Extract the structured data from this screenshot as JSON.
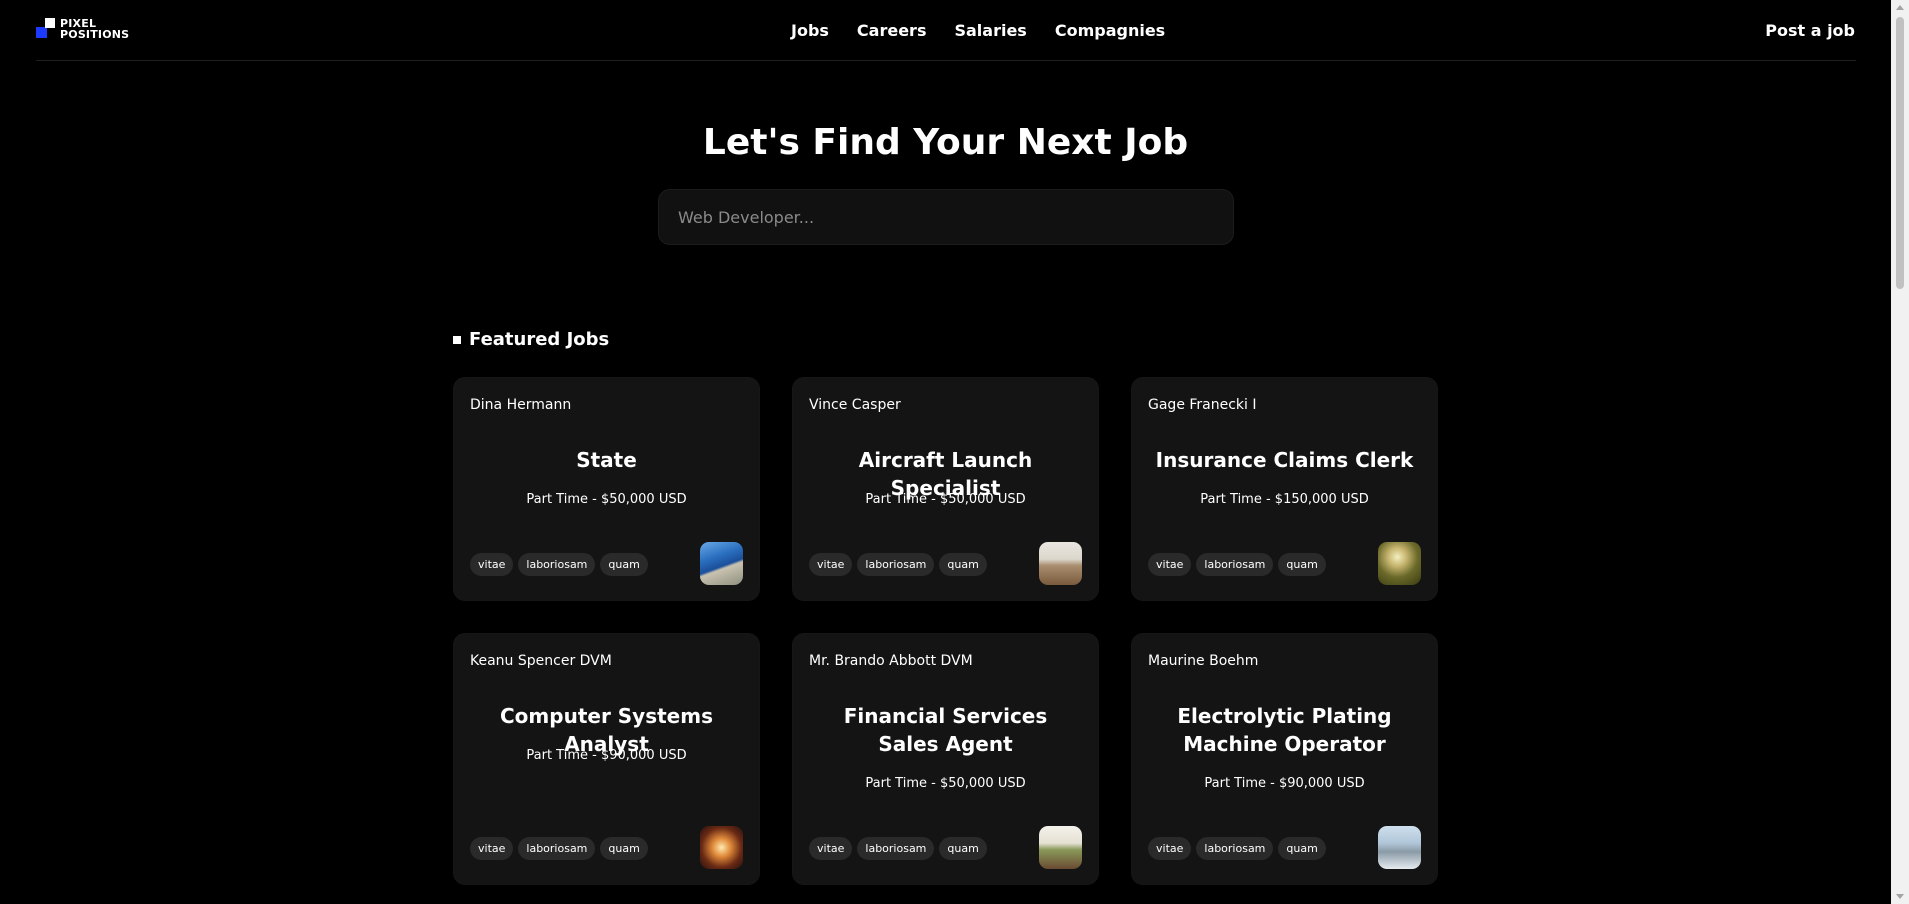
{
  "header": {
    "logo_line1": "PIXEL",
    "logo_line2": "POSITIONS",
    "nav": [
      "Jobs",
      "Careers",
      "Salaries",
      "Compagnies"
    ],
    "post_job": "Post a job"
  },
  "hero": {
    "title": "Let's Find Your Next Job",
    "search_placeholder": "Web Developer..."
  },
  "featured": {
    "heading": "Featured Jobs",
    "cards": [
      {
        "employer": "Dina Hermann",
        "title": "State",
        "salary": "Part Time - $50,000 USD",
        "tags": [
          "vitae",
          "laboriosam",
          "quam"
        ],
        "thumb_icon": "employer-logo-image"
      },
      {
        "employer": "Vince Casper",
        "title": "Aircraft Launch Specialist",
        "salary": "Part Time - $50,000 USD",
        "tags": [
          "vitae",
          "laboriosam",
          "quam"
        ],
        "thumb_icon": "employer-logo-image"
      },
      {
        "employer": "Gage Franecki I",
        "title": "Insurance Claims Clerk",
        "salary": "Part Time - $150,000 USD",
        "tags": [
          "vitae",
          "laboriosam",
          "quam"
        ],
        "thumb_icon": "employer-logo-image"
      },
      {
        "employer": "Keanu Spencer DVM",
        "title": "Computer Systems Analyst",
        "salary": "Part Time - $90,000 USD",
        "tags": [
          "vitae",
          "laboriosam",
          "quam"
        ],
        "thumb_icon": "employer-logo-image"
      },
      {
        "employer": "Mr. Brando Abbott DVM",
        "title": "Financial Services Sales Agent",
        "salary": "Part Time - $50,000 USD",
        "tags": [
          "vitae",
          "laboriosam",
          "quam"
        ],
        "thumb_icon": "employer-logo-image"
      },
      {
        "employer": "Maurine Boehm",
        "title": "Electrolytic Plating Machine Operator",
        "salary": "Part Time - $90,000 USD",
        "tags": [
          "vitae",
          "laboriosam",
          "quam"
        ],
        "thumb_icon": "employer-logo-image"
      }
    ]
  },
  "colors": {
    "background": "#000000",
    "card": "#141414",
    "tag": "#2a2a2a",
    "logo_accent": "#1d3bff"
  }
}
